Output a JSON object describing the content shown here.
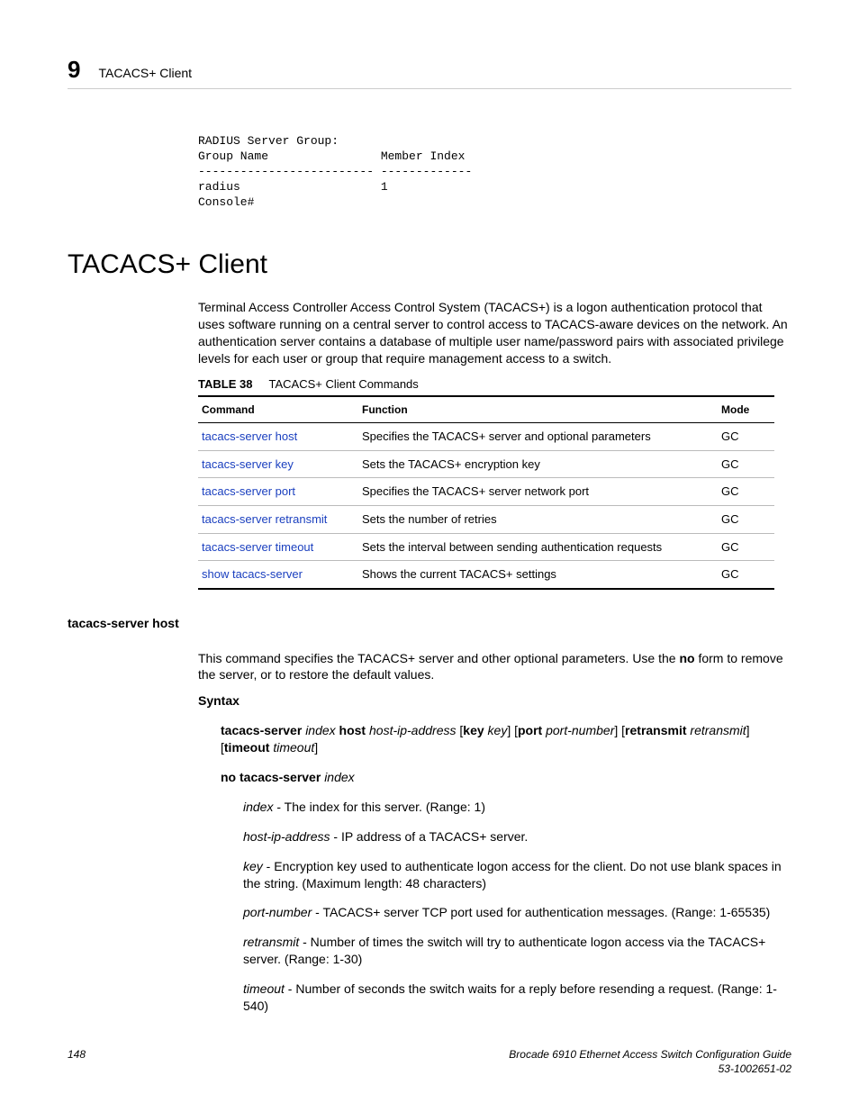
{
  "header": {
    "chapter_number": "9",
    "chapter_label": "TACACS+ Client"
  },
  "code_block": "RADIUS Server Group:\nGroup Name                Member Index\n------------------------- -------------\nradius                    1\nConsole#",
  "section_title": "TACACS+ Client",
  "intro_para": "Terminal Access Controller Access Control System (TACACS+) is a logon authentication protocol that uses software running on a central server to control access to TACACS-aware devices on the network. An authentication server contains a database of multiple user name/password pairs with associated privilege levels for each user or group that require management access to a switch.",
  "table_caption": {
    "label": "TABLE 38",
    "title": "TACACS+ Client Commands"
  },
  "table": {
    "headers": {
      "c1": "Command",
      "c2": "Function",
      "c3": "Mode"
    },
    "rows": [
      {
        "cmd": "tacacs-server host",
        "fn": "Specifies the TACACS+ server and optional parameters",
        "mode": "GC"
      },
      {
        "cmd": "tacacs-server key",
        "fn": "Sets the TACACS+ encryption key",
        "mode": "GC"
      },
      {
        "cmd": "tacacs-server port",
        "fn": "Specifies the TACACS+ server network port",
        "mode": "GC"
      },
      {
        "cmd": "tacacs-server retransmit",
        "fn": "Sets the number of retries",
        "mode": "GC"
      },
      {
        "cmd": "tacacs-server timeout",
        "fn": "Sets the interval between sending authentication requests",
        "mode": "GC"
      },
      {
        "cmd": "show tacacs-server",
        "fn": "Shows the current TACACS+ settings",
        "mode": "GC"
      }
    ]
  },
  "cmd_section": {
    "title": "tacacs-server host",
    "description": "This command specifies the TACACS+ server and other optional parameters. Use the ",
    "description_bold": "no",
    "description_tail": " form to remove the server, or to restore the default values.",
    "syntax_label": "Syntax",
    "syntax1": {
      "p1": "tacacs-server ",
      "p2": "index ",
      "p3": "host ",
      "p4": "host-ip-address ",
      "p5": "[",
      "p6": "key ",
      "p7": "key",
      "p8": "] [",
      "p9": "port ",
      "p10": "port-number",
      "p11": "] [",
      "p12": "retransmit ",
      "p13": "retransmit",
      "p14": "] [",
      "p15": "timeout ",
      "p16": "timeout",
      "p17": "]"
    },
    "syntax2": {
      "p1": "no tacacs-server ",
      "p2": "index"
    },
    "params": [
      {
        "name": "index",
        "desc": " - The index for this server. (Range: 1)"
      },
      {
        "name": "host-ip-address",
        "desc": " - IP address of a TACACS+ server."
      },
      {
        "name": "key",
        "desc": " - Encryption key used to authenticate logon access for the client. Do not use blank spaces in the string. (Maximum length: 48 characters)"
      },
      {
        "name": "port-number",
        "desc": " - TACACS+ server TCP port used for authentication messages. (Range: 1-65535)"
      },
      {
        "name": "retransmit",
        "desc": " - Number of times the switch will try to authenticate logon access via the TACACS+ server. (Range: 1-30)"
      },
      {
        "name": "timeout",
        "desc": " - Number of seconds the switch waits for a reply before resending a request. (Range: 1-540)"
      }
    ]
  },
  "footer": {
    "page": "148",
    "title": "Brocade 6910 Ethernet Access Switch Configuration Guide",
    "docnum": "53-1002651-02"
  }
}
